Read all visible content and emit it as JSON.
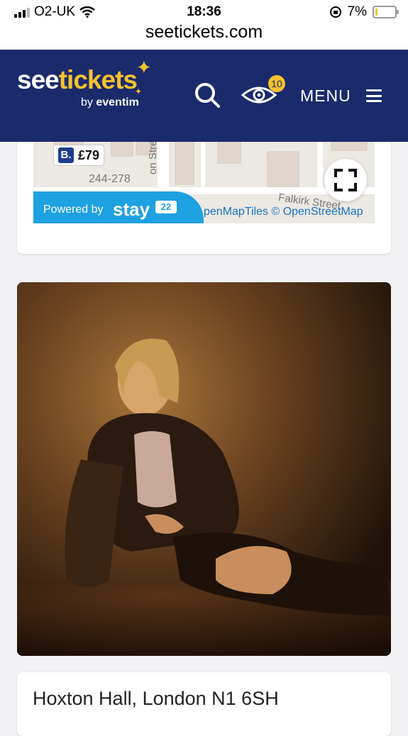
{
  "status_bar": {
    "carrier": "O2-UK",
    "time": "18:36",
    "battery": "7%"
  },
  "browser": {
    "url": "seetickets.com"
  },
  "header": {
    "logo_see": "see",
    "logo_tickets": "tickets",
    "logo_by": "by",
    "logo_eventim": "eventim",
    "watchlist_count": "10",
    "menu_label": "MENU",
    "brand_color": "#1b2a6b",
    "accent_color": "#f6c22d"
  },
  "map": {
    "price_badge_letter": "B.",
    "price": "£79",
    "label_house_numbers": "244-278",
    "label_street": "on Street",
    "label_street2": "Falkirk Street",
    "attribution": "penMapTiles © OpenStreetMap",
    "powered_by": "Powered by",
    "stay_brand": "stay",
    "stay_number": "22"
  },
  "venue": {
    "address": "Hoxton Hall, London N1 6SH"
  }
}
